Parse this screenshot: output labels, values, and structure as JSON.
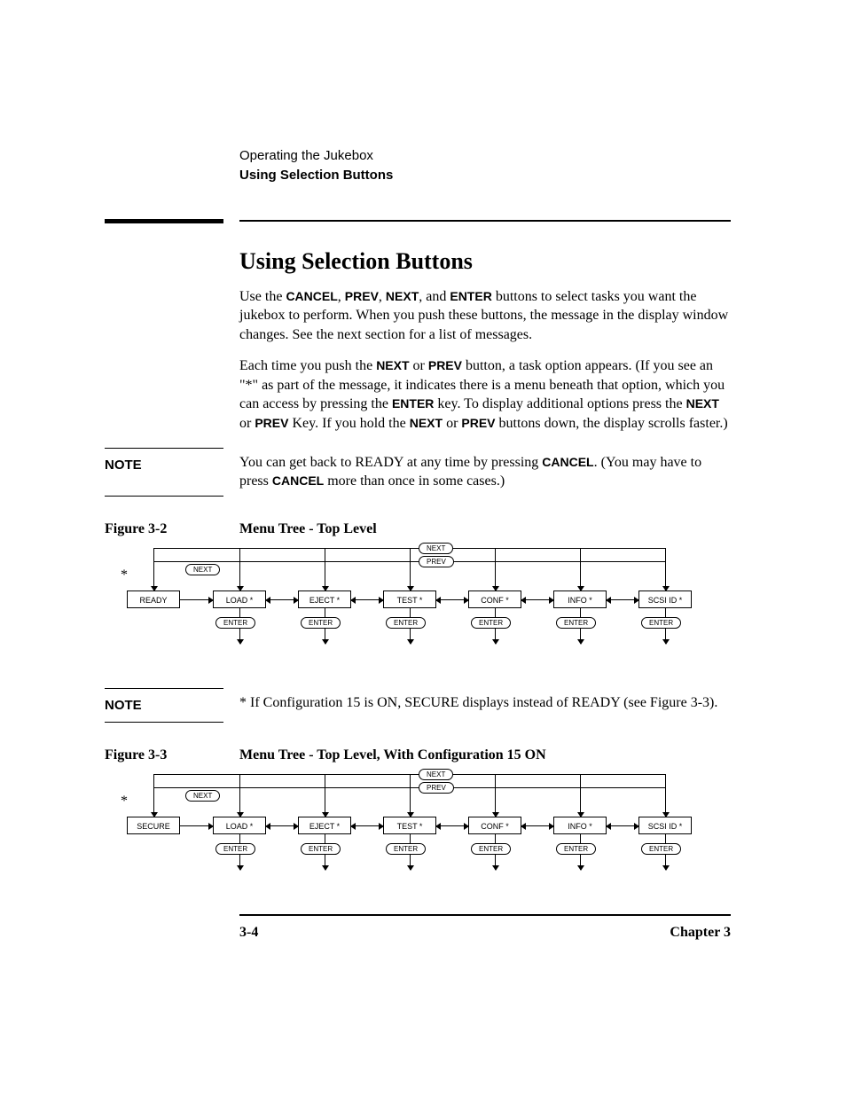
{
  "header": {
    "chapter_name": "Operating the Jukebox",
    "section_name": "Using Selection Buttons"
  },
  "section_title": "Using Selection Buttons",
  "para1": {
    "pre": "Use the ",
    "b1": "CANCEL",
    "sep1": ", ",
    "b2": "PREV",
    "sep2": ", ",
    "b3": "NEXT",
    "sep3": ", and ",
    "b4": "ENTER",
    "post": " buttons to select tasks you want the jukebox to perform. When you push these buttons, the message in the display window changes. See the next section for a list of messages."
  },
  "para2": {
    "pre": "Each time you push the ",
    "b1": "NEXT",
    "mid1": " or ",
    "b2": "PREV",
    "mid2": " button, a task option appears. (If you see an \"*\" as part of the message, it indicates there is a menu beneath that option, which you can access by pressing the ",
    "b3": "ENTER",
    "mid3": " key. To display additional options press the ",
    "b4": "NEXT",
    "mid4": " or ",
    "b5": "PREV",
    "mid5": " Key. If you hold the ",
    "b6": "NEXT",
    "mid6": " or ",
    "b7": "PREV",
    "post": " buttons down, the display scrolls faster.)"
  },
  "note1": {
    "label": "NOTE",
    "pre": "You can get back to READY at any time by pressing ",
    "b1": "CANCEL",
    "mid": ".   (You may have to press ",
    "b2": "CANCEL",
    "post": " more than once in some cases.)"
  },
  "figure1": {
    "num": "Figure 3-2",
    "title": "Menu Tree - Top Level"
  },
  "diagram_labels": {
    "next": "NEXT",
    "prev": "PREV",
    "enter": "ENTER",
    "ready": "READY",
    "secure": "SECURE",
    "load": "LOAD *",
    "eject": "EJECT *",
    "test": "TEST *",
    "conf": "CONF *",
    "info": "INFO *",
    "scsi": "SCSI ID *",
    "ast": "*"
  },
  "note2": {
    "label": "NOTE",
    "text": "* If Configuration 15 is ON, SECURE displays instead of READY (see Figure 3-3)."
  },
  "figure2": {
    "num": "Figure 3-3",
    "title": "Menu Tree - Top Level, With Configuration 15 ON"
  },
  "footer": {
    "page": "3-4",
    "chapter": "Chapter 3"
  }
}
